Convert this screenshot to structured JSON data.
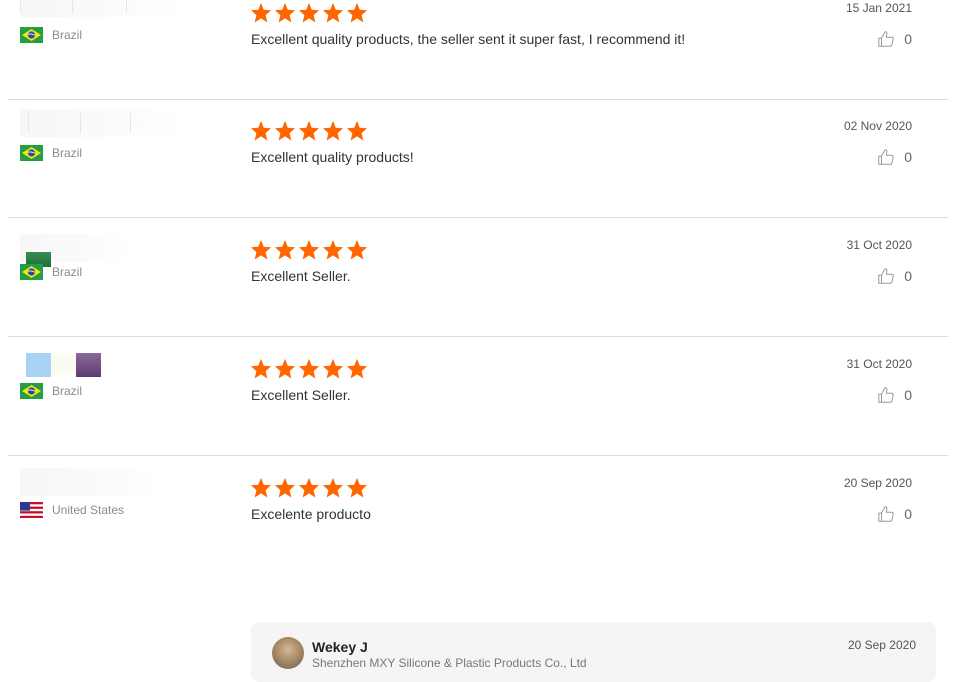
{
  "colors": {
    "star": "#ff6600",
    "divider": "#dcdcdc"
  },
  "reviews": [
    {
      "country": "Brazil",
      "flag": "brazil-flag",
      "stars": 5,
      "text": "Excellent quality products, the seller sent it super fast, I recommend it!",
      "date": "15 Jan 2021",
      "likes": "0"
    },
    {
      "country": "Brazil",
      "flag": "brazil-flag",
      "stars": 5,
      "text": "Excellent quality products!",
      "date": "02 Nov 2020",
      "likes": "0"
    },
    {
      "country": "Brazil",
      "flag": "brazil-flag",
      "stars": 5,
      "text": "Excellent Seller.",
      "date": "31 Oct 2020",
      "likes": "0"
    },
    {
      "country": "Brazil",
      "flag": "brazil-flag",
      "stars": 5,
      "text": "Excellent Seller.",
      "date": "31 Oct 2020",
      "likes": "0"
    },
    {
      "country": "United States",
      "flag": "us-flag",
      "stars": 5,
      "text": "Excelente producto",
      "date": "20 Sep 2020",
      "likes": "0"
    }
  ],
  "reply": {
    "name": "Wekey J",
    "company": "Shenzhen MXY Silicone & Plastic Products Co., Ltd",
    "date": "20 Sep 2020"
  }
}
